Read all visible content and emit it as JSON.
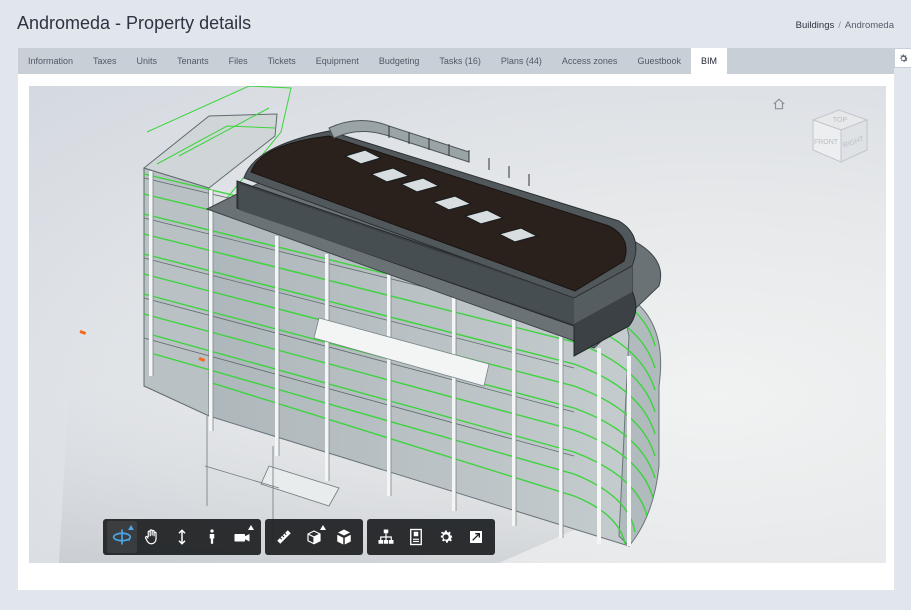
{
  "page": {
    "title": "Andromeda - Property details"
  },
  "breadcrumb": {
    "items": [
      "Buildings",
      "Andromeda"
    ],
    "separator": "/"
  },
  "tabs": [
    {
      "label": "Information"
    },
    {
      "label": "Taxes"
    },
    {
      "label": "Units"
    },
    {
      "label": "Tenants"
    },
    {
      "label": "Files"
    },
    {
      "label": "Tickets"
    },
    {
      "label": "Equipment"
    },
    {
      "label": "Budgeting"
    },
    {
      "label": "Tasks (16)"
    },
    {
      "label": "Plans (44)"
    },
    {
      "label": "Access zones"
    },
    {
      "label": "Guestbook"
    },
    {
      "label": "BIM",
      "active": true
    }
  ],
  "viewer": {
    "viewcube": {
      "top": "TOP",
      "front": "FRONT",
      "right": "RIGHT"
    },
    "toolbar": {
      "groups": [
        [
          {
            "icon": "orbit-icon",
            "active": true,
            "submenu": true
          },
          {
            "icon": "pan-hand-icon"
          },
          {
            "icon": "zoom-icon"
          },
          {
            "icon": "first-person-icon"
          },
          {
            "icon": "camera-icon",
            "submenu": true
          }
        ],
        [
          {
            "icon": "measure-ruler-icon"
          },
          {
            "icon": "section-box-icon",
            "submenu": true
          },
          {
            "icon": "explode-model-icon"
          }
        ],
        [
          {
            "icon": "model-browser-icon"
          },
          {
            "icon": "properties-icon"
          },
          {
            "icon": "settings-gear-icon"
          },
          {
            "icon": "fullscreen-icon"
          }
        ]
      ]
    }
  },
  "colors": {
    "accent": "#4aa8e8",
    "highlight_edges": "#3cd43c",
    "roof": "#2a201c",
    "background": "#e1e5ec"
  }
}
